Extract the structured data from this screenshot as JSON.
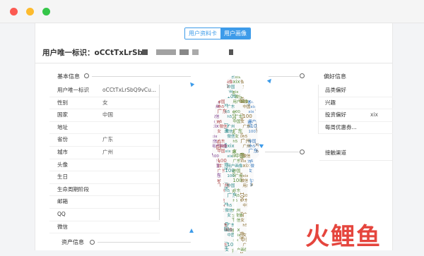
{
  "window": {
    "controls": [
      "close",
      "minimize",
      "maximize"
    ]
  },
  "tabs": [
    {
      "label": "用户资料卡",
      "active": false
    },
    {
      "label": "用户画像",
      "active": true
    }
  ],
  "header": {
    "uid_text": "用户唯一标识：oCCtTxLrSb"
  },
  "sections": {
    "basic": "基本信息",
    "asset": "资产信息",
    "preference": "偏好信息",
    "channel": "接触渠道"
  },
  "basic_rows": [
    {
      "key": "用户唯一标识",
      "value": "oCCtTxLrSbQ9vCu..."
    },
    {
      "key": "性别",
      "value": "女"
    },
    {
      "key": "国家",
      "value": "中国"
    },
    {
      "key": "地址",
      "value": ""
    },
    {
      "key": "省份",
      "value": "广东"
    },
    {
      "key": "城市",
      "value": "广州"
    },
    {
      "key": "头像",
      "value": ""
    },
    {
      "key": "生日",
      "value": ""
    },
    {
      "key": "生命周期阶段",
      "value": ""
    },
    {
      "key": "邮箱",
      "value": ""
    },
    {
      "key": "QQ",
      "value": ""
    },
    {
      "key": "微信",
      "value": ""
    }
  ],
  "preference_rows": [
    {
      "key": "品类偏好",
      "value": ""
    },
    {
      "key": "兴趣",
      "value": ""
    },
    {
      "key": "投资偏好",
      "value": "xix"
    },
    {
      "key": "每周优惠券...",
      "value": ""
    }
  ],
  "wordcloud": {
    "words": [
      "100",
      "微信",
      "广东",
      "xix",
      "h5",
      "广州",
      "中国",
      "女",
      "用户画像",
      "100",
      "xix",
      "微信",
      "广州",
      "h5",
      "广东",
      "100",
      "中国",
      "xix",
      "女",
      "微信",
      "广东",
      "h5",
      "100",
      "广州",
      "xix",
      "中国",
      "微信",
      "女",
      "h5",
      "广东"
    ],
    "colors": [
      "#7a3a8c",
      "#3b7bbf",
      "#5b8d3a",
      "#b04a4a",
      "#444444",
      "#8a6d2f",
      "#2e8b8b"
    ]
  },
  "watermark": {
    "logo_text": [
      "火",
      "鲤",
      "鱼"
    ],
    "color": "#e5453d"
  }
}
